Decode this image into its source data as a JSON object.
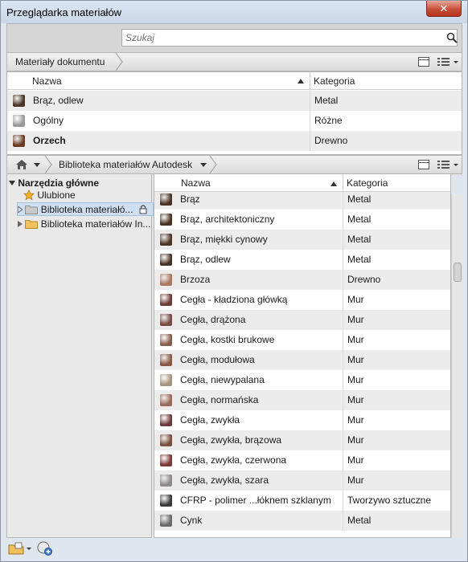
{
  "window": {
    "title": "Przeglądarka materiałów",
    "close_glyph": "✕"
  },
  "search": {
    "placeholder": "Szukaj"
  },
  "doc": {
    "label": "Materiały dokumentu",
    "columns": {
      "name": "Nazwa",
      "category": "Kategoria"
    },
    "rows": [
      {
        "name": "Brąz, odlew",
        "category": "Metal",
        "color": "#4b3424"
      },
      {
        "name": "Ogólny",
        "category": "Różne",
        "color": "#9a9a9a"
      },
      {
        "name": "Orzech",
        "category": "Drewno",
        "color": "#6a3a24"
      }
    ]
  },
  "library": {
    "crumb": "Biblioteka materiałów Autodesk",
    "columns": {
      "name": "Nazwa",
      "category": "Kategoria"
    },
    "rows": [
      {
        "name": "Brąz",
        "category": "Metal",
        "color": "#4a3120"
      },
      {
        "name": "Brąz, architektoniczny",
        "category": "Metal",
        "color": "#4b3222"
      },
      {
        "name": "Brąz, miękki cynowy",
        "category": "Metal",
        "color": "#4d3524"
      },
      {
        "name": "Brąz, odlew",
        "category": "Metal",
        "color": "#4a3323"
      },
      {
        "name": "Brzoza",
        "category": "Drewno",
        "color": "#a87860"
      },
      {
        "name": "Cegła - kładziona główką",
        "category": "Mur",
        "color": "#6e3b36"
      },
      {
        "name": "Cegła, drążona",
        "category": "Mur",
        "color": "#7a4a44"
      },
      {
        "name": "Cegła, kostki brukowe",
        "category": "Mur",
        "color": "#8a5c4c"
      },
      {
        "name": "Cegła, modułowa",
        "category": "Mur",
        "color": "#8a5744"
      },
      {
        "name": "Cegła, niewypalana",
        "category": "Mur",
        "color": "#a6937e"
      },
      {
        "name": "Cegła, normańska",
        "category": "Mur",
        "color": "#9a6a58"
      },
      {
        "name": "Cegła, zwykła",
        "category": "Mur",
        "color": "#6e3c38"
      },
      {
        "name": "Cegła, zwykła, brązowa",
        "category": "Mur",
        "color": "#7a5040"
      },
      {
        "name": "Cegła, zwykła, czerwona",
        "category": "Mur",
        "color": "#7a3a36"
      },
      {
        "name": "Cegła, zwykła, szara",
        "category": "Mur",
        "color": "#8e8a88"
      },
      {
        "name": "CFRP - polimer ...łóknem szklanym",
        "category": "Tworzywo sztuczne",
        "color": "#3a3a3a"
      },
      {
        "name": "Cynk",
        "category": "Metal",
        "color": "#6a6a6a"
      }
    ]
  },
  "tree": {
    "root": "Narzędzia główne",
    "items": [
      {
        "label": "Ulubione"
      },
      {
        "label": "Biblioteka materiałó..."
      },
      {
        "label": "Biblioteka materiałów In..."
      }
    ]
  }
}
